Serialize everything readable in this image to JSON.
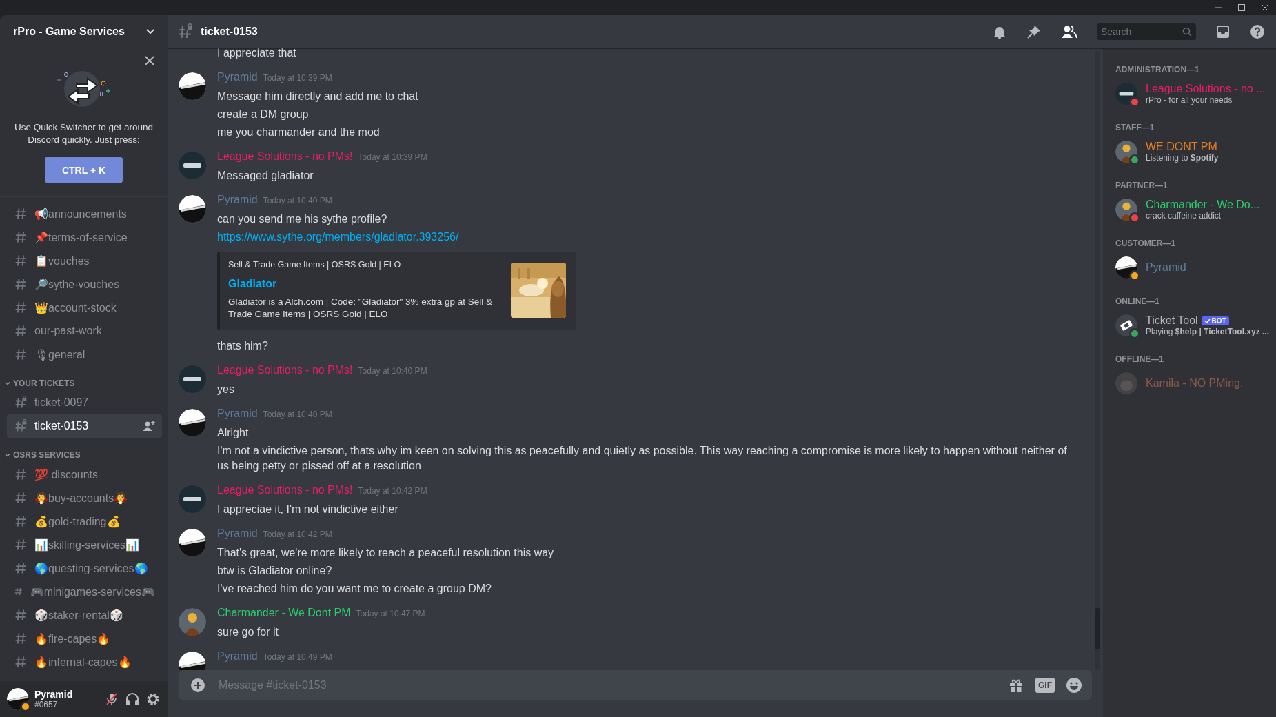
{
  "server": {
    "name": "rPro - Game Services"
  },
  "quick_switcher": {
    "text": "Use Quick Switcher to get around Discord quickly. Just press:",
    "shortcut": "CTRL + K"
  },
  "channels": [
    {
      "name": "📢announcements",
      "kind": "text",
      "selected": false
    },
    {
      "name": "📌terms-of-service",
      "kind": "text",
      "selected": false
    },
    {
      "name": "📋vouches",
      "kind": "text",
      "selected": false
    },
    {
      "name": "🔎sythe-vouches",
      "kind": "text",
      "selected": false
    },
    {
      "name": "👑account-stock",
      "kind": "text",
      "selected": false
    },
    {
      "name": "our-past-work",
      "kind": "text",
      "selected": false
    },
    {
      "name": "🎙general",
      "kind": "text",
      "selected": false
    }
  ],
  "categories": [
    {
      "name": "YOUR TICKETS",
      "expanded": true,
      "channels": [
        {
          "name": "ticket-0097",
          "kind": "private",
          "selected": false
        },
        {
          "name": "ticket-0153",
          "kind": "private",
          "selected": true
        }
      ]
    },
    {
      "name": "OSRS SERVICES",
      "expanded": true,
      "channels": [
        {
          "name": "💯 discounts",
          "kind": "text",
          "selected": false
        },
        {
          "name": "🧛buy-accounts🧛",
          "kind": "text",
          "selected": false
        },
        {
          "name": "💰gold-trading💰",
          "kind": "text",
          "selected": false
        },
        {
          "name": "📊skilling-services📊",
          "kind": "text",
          "selected": false
        },
        {
          "name": "🌎questing-services🌎",
          "kind": "text",
          "selected": false
        },
        {
          "name": "🎮minigames-services🎮",
          "kind": "text",
          "selected": false
        },
        {
          "name": "🎲staker-rental🎲",
          "kind": "text",
          "selected": false
        },
        {
          "name": "🔥fire-capes🔥",
          "kind": "text",
          "selected": false
        },
        {
          "name": "🔥infernal-capes🔥",
          "kind": "text",
          "selected": false
        }
      ]
    }
  ],
  "user_panel": {
    "name": "Pyramid",
    "tag": "#0657",
    "status": {
      "color": "#faa61a"
    },
    "muted": true
  },
  "channel_header": {
    "name": "ticket-0153",
    "search_placeholder": "Search"
  },
  "messages": [
    {
      "lines": [
        {
          "kind": "text",
          "text": "I appreciate that"
        }
      ]
    },
    {
      "author": "Pyramid",
      "color": "#607d9b",
      "avatar": {
        "kind": "light"
      },
      "time": "Today at 10:39 PM",
      "lines": [
        {
          "kind": "text",
          "text": "Message him directly and add me to chat"
        },
        {
          "kind": "text",
          "text": "create a DM group"
        },
        {
          "kind": "text",
          "text": "me you charmander and the mod"
        }
      ]
    },
    {
      "author": "League Solutions - no PMs!",
      "color": "#e91e63",
      "avatar": {
        "kind": "dark"
      },
      "time": "Today at 10:39 PM",
      "lines": [
        {
          "kind": "text",
          "text": "Messaged gladiator"
        }
      ]
    },
    {
      "author": "Pyramid",
      "color": "#607d9b",
      "avatar": {
        "kind": "light"
      },
      "time": "Today at 10:40 PM",
      "lines": [
        {
          "kind": "text",
          "text": "can you send me his sythe profile?"
        },
        {
          "kind": "link",
          "text": "https://www.sythe.org/members/gladiator.393256/"
        },
        {
          "kind": "embed",
          "provider": "Sell & Trade Game Items | OSRS Gold | ELO",
          "title": "Gladiator",
          "description": "Gladiator is a Alch.com | Code: \"Gladiator\" 3% extra gp at Sell & Trade Game Items | OSRS Gold | ELO"
        },
        {
          "kind": "text",
          "text": "thats him?"
        }
      ]
    },
    {
      "author": "League Solutions - no PMs!",
      "color": "#e91e63",
      "avatar": {
        "kind": "dark"
      },
      "time": "Today at 10:40 PM",
      "lines": [
        {
          "kind": "text",
          "text": "yes"
        }
      ]
    },
    {
      "author": "Pyramid",
      "color": "#607d9b",
      "avatar": {
        "kind": "light"
      },
      "time": "Today at 10:40 PM",
      "lines": [
        {
          "kind": "text",
          "text": "Alright"
        },
        {
          "kind": "text",
          "text": "I'm not a vindictive person, thats why im keen on solving this as peacefully and quietly as possible. This way reaching a compromise is more likely to happen without neither of us being petty or pissed off at a resolution"
        }
      ]
    },
    {
      "author": "League Solutions - no PMs!",
      "color": "#e91e63",
      "avatar": {
        "kind": "dark"
      },
      "time": "Today at 10:42 PM",
      "lines": [
        {
          "kind": "text",
          "text": "I appreciae it, I'm not vindictive either"
        }
      ]
    },
    {
      "author": "Pyramid",
      "color": "#607d9b",
      "avatar": {
        "kind": "light"
      },
      "time": "Today at 10:42 PM",
      "lines": [
        {
          "kind": "text",
          "text": "That's great, we're more likely to reach a peaceful resolution this way"
        },
        {
          "kind": "text",
          "text": "btw is Gladiator online?"
        },
        {
          "kind": "text",
          "text": "I've reached him do you want me to create a group DM?"
        }
      ]
    },
    {
      "author": "Charmander - We Dont PM",
      "color": "#2ecc71",
      "avatar": {
        "kind": "figure"
      },
      "time": "Today at 10:47 PM",
      "lines": [
        {
          "kind": "text",
          "text": "sure go for it"
        }
      ]
    },
    {
      "author": "Pyramid",
      "color": "#607d9b",
      "avatar": {
        "kind": "light"
      },
      "time": "Today at 10:49 PM"
    }
  ],
  "composer": {
    "placeholder": "Message #ticket-0153",
    "gif_label": "GIF"
  },
  "member_groups": [
    {
      "title": "ADMINISTRATION—1",
      "members": [
        {
          "name": "League Solutions - no ...",
          "color": "#e91e63",
          "avatar": {
            "kind": "dark"
          },
          "status": {
            "color": "#ed4245"
          },
          "activity": "rPro - for all your needs"
        }
      ]
    },
    {
      "title": "STAFF—1",
      "members": [
        {
          "name": "WE DONT PM",
          "color": "#e67e22",
          "avatar": {
            "kind": "figure"
          },
          "status": {
            "color": "#3ba55d"
          },
          "activity": "Listening to **Spotify**"
        }
      ]
    },
    {
      "title": "PARTNER—1",
      "members": [
        {
          "name": "Charmander - We Do...",
          "color": "#2ecc71",
          "avatar": {
            "kind": "figure"
          },
          "status": {
            "color": "#ed4245"
          },
          "activity": "crack caffeine addict"
        }
      ]
    },
    {
      "title": "CUSTOMER—1",
      "members": [
        {
          "name": "Pyramid",
          "color": "#607d9b",
          "avatar": {
            "kind": "light"
          },
          "status": {
            "color": "#faa61a"
          }
        }
      ]
    },
    {
      "title": "ONLINE—1",
      "members": [
        {
          "name": "Ticket Tool",
          "color": "#b9bbbe",
          "avatar": {
            "kind": "ticket"
          },
          "status": {
            "color": "#3ba55d"
          },
          "badge": "BOT",
          "activity": "Playing **$help | TicketTool.xyz ...**"
        }
      ]
    },
    {
      "title": "OFFLINE—1",
      "members": [
        {
          "name": "Kamila - NO PMing.",
          "color": "#8a5a48",
          "avatar": {
            "kind": "cat"
          },
          "offline": true
        }
      ]
    }
  ]
}
